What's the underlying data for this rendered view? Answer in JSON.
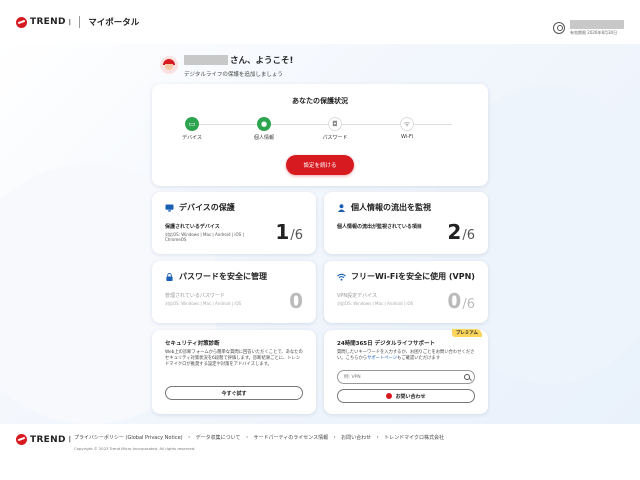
{
  "header": {
    "brand": "TREND",
    "portal": "マイポータル",
    "user_date": "有効期限 2026年8月30日"
  },
  "greeting": {
    "suffix": "さん、ようこそ!",
    "sub": "デジタルライフの保護を追加しましょう"
  },
  "status": {
    "title": "あなたの保護状況",
    "steps": [
      {
        "label": "デバイス",
        "icon": "monitor-icon",
        "state": "ok"
      },
      {
        "label": "個人情報",
        "icon": "person-icon",
        "state": "ok"
      },
      {
        "label": "パスワード",
        "icon": "lock-icon",
        "state": "none"
      },
      {
        "label": "Wi-Fi",
        "icon": "wifi-icon",
        "state": "none"
      }
    ],
    "button": "設定を続ける"
  },
  "features": {
    "device": {
      "title": "デバイスの保護",
      "label": "保護されているデバイス",
      "sub": "対応OS: Windows | Mac | Android | iOS | ChromeOS",
      "count": "1",
      "total": "6"
    },
    "identity": {
      "title": "個人情報の流出を監視",
      "label": "個人情報の流出が監視されている項目",
      "count": "2",
      "total": "6"
    },
    "password": {
      "title": "パスワードを安全に管理",
      "label": "管理されているパスワード",
      "sub": "対応OS: Windows | Mac | Android | iOS",
      "count": "0"
    },
    "vpn": {
      "title": "フリーWi-Fiを安全に使用 (VPN)",
      "label": "VPN設定デバイス",
      "sub": "対応OS: Windows | Mac | Android | iOS",
      "count": "0",
      "total": "6"
    }
  },
  "security": {
    "title": "セキュリティ対策診断",
    "desc": "Web上の診断フォームから簡単な質問に回答いただくことで、あなたのセキュリティ対策状況を6段階で評価します。診断結果ごとに、トレンドマイクロが推奨する設定や対策をアドバイスします。",
    "button": "今すぐ試す"
  },
  "support": {
    "badge": "プレミアム",
    "title": "24時間365日 デジタルライフサポート",
    "desc_before": "質問したいキーワードを入力するか、お困りごとをお問い合わせください。こちらから",
    "desc_link": "サポートページ",
    "desc_after": "もご確認いただけます",
    "search_placeholder": "例: VPN",
    "contact": "お問い合わせ"
  },
  "footer": {
    "brand": "TREND",
    "links": [
      "プライバシーポリシー (Global Privacy Notice)",
      "・",
      "データ収集について",
      "・",
      "サードパーティのライセンス情報",
      "・",
      "お問い合わせ",
      "・",
      "トレンドマイクロ株式会社"
    ],
    "copyright": "Copyright © 2023 Trend Micro Incorporated. All rights reserved."
  },
  "colors": {
    "accent": "#d71920",
    "ok": "#2ea44f",
    "icon_blue": "#1a5fb4"
  }
}
